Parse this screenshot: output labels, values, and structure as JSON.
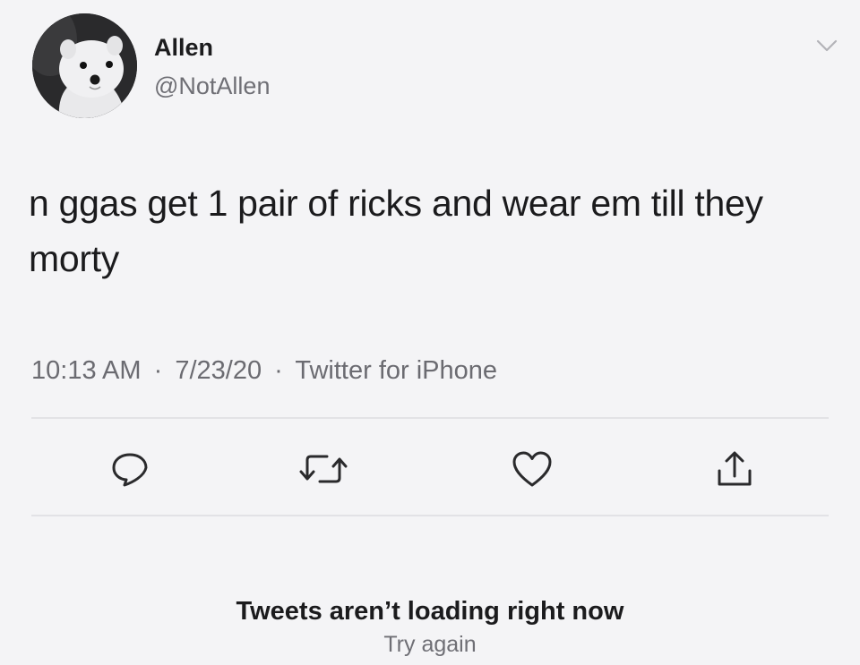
{
  "author": {
    "name": "Allen",
    "handle": "@NotAllen",
    "avatar_icon": "ermine-avatar"
  },
  "tweet": {
    "text": "n ggas get 1 pair of ricks and wear em till they morty",
    "time": "10:13 AM",
    "date": "7/23/20",
    "source": "Twitter for iPhone",
    "separator": "·"
  },
  "actions": [
    {
      "name": "reply",
      "icon": "speech-bubble-icon"
    },
    {
      "name": "retweet",
      "icon": "retweet-arrows-icon"
    },
    {
      "name": "like",
      "icon": "heart-icon"
    },
    {
      "name": "share",
      "icon": "share-upload-icon"
    }
  ],
  "footer": {
    "message": "Tweets aren’t loading right now",
    "retry_label": "Try again"
  },
  "colors": {
    "background": "#f4f4f6",
    "text": "#1b1b1d",
    "secondary": "#6b6b71",
    "divider": "#e2e2e6"
  }
}
